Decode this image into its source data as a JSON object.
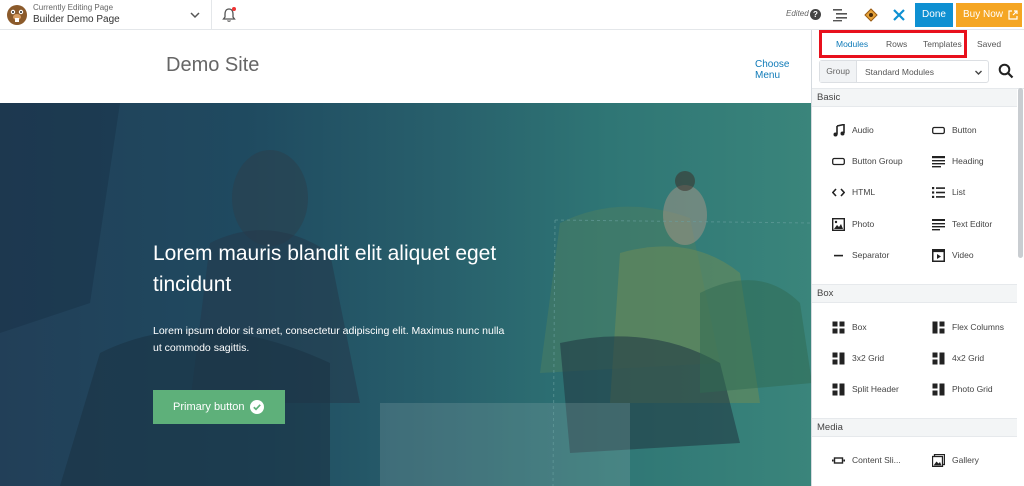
{
  "topbar": {
    "editing_label": "Currently Editing Page",
    "page_name": "Builder Demo Page",
    "edited_status": "Edited",
    "done_label": "Done",
    "buy_now_label": "Buy Now",
    "accent_color": "#0e90d2",
    "buy_now_color": "#f5a623"
  },
  "site": {
    "title": "Demo Site",
    "menu_link": "Choose Menu"
  },
  "hero": {
    "heading": "Lorem mauris blandit elit aliquet eget tincidunt",
    "body": "Lorem ipsum dolor sit amet, consectetur adipiscing elit. Maximus nunc nulla ut commodo sagittis.",
    "button_label": "Primary button",
    "button_color": "#5eb07a"
  },
  "panel": {
    "tabs": [
      {
        "label": "Modules",
        "active": true
      },
      {
        "label": "Rows",
        "active": false
      },
      {
        "label": "Templates",
        "active": false
      },
      {
        "label": "Saved",
        "active": false
      }
    ],
    "group_label": "Group",
    "group_value": "Standard Modules",
    "sections": [
      {
        "title": "Basic",
        "modules": [
          {
            "label": "Audio",
            "icon": "music-note-icon"
          },
          {
            "label": "Button",
            "icon": "button-icon"
          },
          {
            "label": "Button Group",
            "icon": "button-group-icon"
          },
          {
            "label": "Heading",
            "icon": "heading-icon"
          },
          {
            "label": "HTML",
            "icon": "code-icon"
          },
          {
            "label": "List",
            "icon": "list-icon"
          },
          {
            "label": "Photo",
            "icon": "photo-icon"
          },
          {
            "label": "Text Editor",
            "icon": "text-editor-icon"
          },
          {
            "label": "Separator",
            "icon": "separator-icon"
          },
          {
            "label": "Video",
            "icon": "video-icon"
          }
        ]
      },
      {
        "title": "Box",
        "modules": [
          {
            "label": "Box",
            "icon": "box-icon"
          },
          {
            "label": "Flex Columns",
            "icon": "flex-columns-icon"
          },
          {
            "label": "3x2 Grid",
            "icon": "grid-icon"
          },
          {
            "label": "4x2 Grid",
            "icon": "grid-icon"
          },
          {
            "label": "Split Header",
            "icon": "split-header-icon"
          },
          {
            "label": "Photo Grid",
            "icon": "photo-grid-icon"
          }
        ]
      },
      {
        "title": "Media",
        "modules": [
          {
            "label": "Content Sli...",
            "icon": "slider-icon"
          },
          {
            "label": "Gallery",
            "icon": "gallery-icon"
          }
        ]
      }
    ]
  }
}
